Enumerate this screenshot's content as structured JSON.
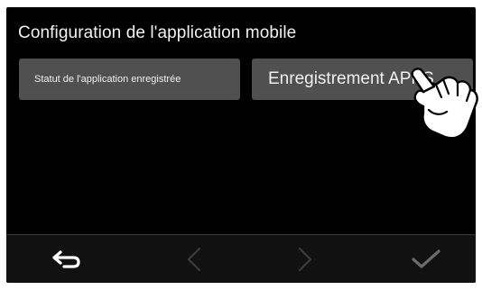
{
  "header": {
    "title": "Configuration de l'application mobile"
  },
  "buttons": {
    "status_label": "Statut de l'application enregistrée",
    "register_label": "Enregistrement APPS"
  },
  "navbar": {
    "items": [
      {
        "icon": "back-arrow-icon",
        "enabled": true
      },
      {
        "icon": "chevron-left-icon",
        "enabled": false
      },
      {
        "icon": "chevron-right-icon",
        "enabled": false
      },
      {
        "icon": "checkmark-icon",
        "enabled": true
      }
    ]
  },
  "colors": {
    "screen_bg": "#000000",
    "button_bg": "#505050",
    "text": "#f0f0f0",
    "nav_active": "#ffffff",
    "nav_inactive": "#3c3c3c",
    "nav_check": "#6a6a6a"
  },
  "overlay": {
    "icon": "pointing-hand-icon"
  }
}
